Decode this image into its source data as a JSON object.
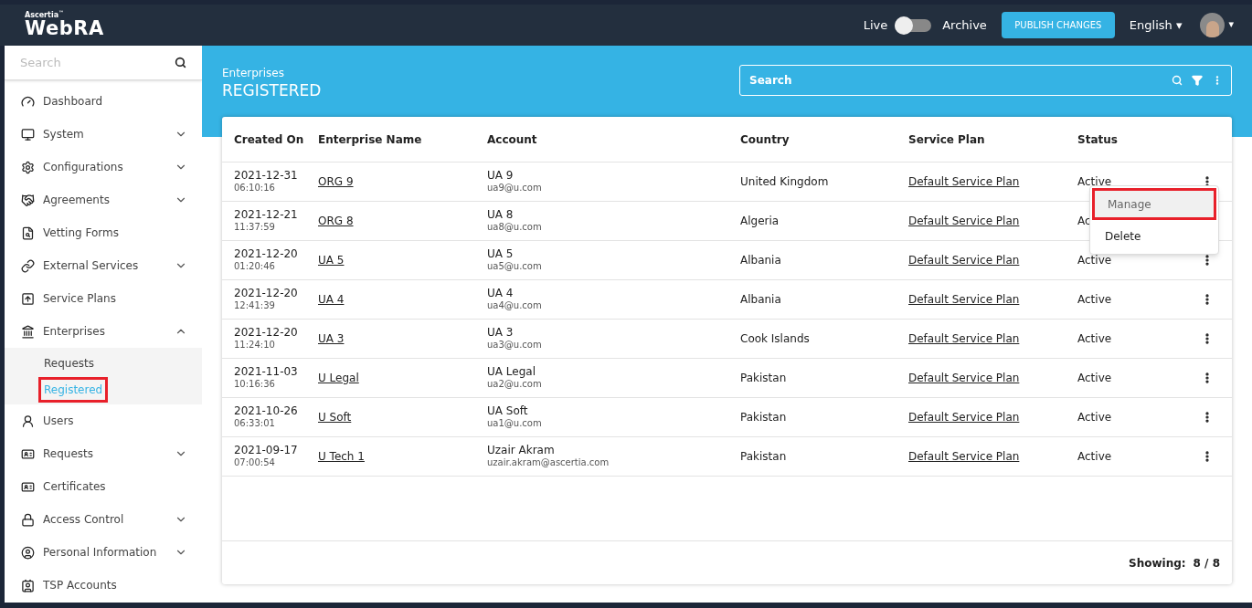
{
  "header": {
    "brand_small": "Ascertia",
    "brand_tm": "™",
    "brand": "WebRA",
    "toggle": {
      "left_label": "Live",
      "right_label": "Archive",
      "on": false
    },
    "publish_button": "PUBLISH CHANGES",
    "language": "English ▾",
    "avatar_caret": "▾"
  },
  "sidebar": {
    "search_placeholder": "Search",
    "items": [
      {
        "label": "Dashboard",
        "kind": "link"
      },
      {
        "label": "System",
        "kind": "group",
        "expanded": false
      },
      {
        "label": "Configurations",
        "kind": "group",
        "expanded": false
      },
      {
        "label": "Agreements",
        "kind": "group",
        "expanded": false
      },
      {
        "label": "Vetting Forms",
        "kind": "link"
      },
      {
        "label": "External Services",
        "kind": "group",
        "expanded": false
      },
      {
        "label": "Service Plans",
        "kind": "link"
      },
      {
        "label": "Enterprises",
        "kind": "group",
        "expanded": true,
        "children": [
          {
            "label": "Requests",
            "selected": false,
            "highlighted": false
          },
          {
            "label": "Registered",
            "selected": true,
            "highlighted": true
          }
        ]
      },
      {
        "label": "Users",
        "kind": "link"
      },
      {
        "label": "Requests",
        "kind": "group",
        "expanded": false
      },
      {
        "label": "Certificates",
        "kind": "link"
      },
      {
        "label": "Access Control",
        "kind": "group",
        "expanded": false
      },
      {
        "label": "Personal Information",
        "kind": "group",
        "expanded": false
      },
      {
        "label": "TSP Accounts",
        "kind": "link"
      }
    ]
  },
  "page": {
    "breadcrumb": "Enterprises",
    "title": "REGISTERED",
    "search_placeholder": "Search"
  },
  "table": {
    "columns": [
      "Created On",
      "Enterprise Name",
      "Account",
      "Country",
      "Service Plan",
      "Status"
    ],
    "rows": [
      {
        "date": "2021-12-31",
        "time": "06:10:16",
        "name": "ORG 9",
        "account": "UA 9",
        "email": "ua9@u.com",
        "country": "United Kingdom",
        "plan": "Default Service Plan",
        "status": "Active"
      },
      {
        "date": "2021-12-21",
        "time": "11:37:59",
        "name": "ORG 8",
        "account": "UA 8",
        "email": "ua8@u.com",
        "country": "Algeria",
        "plan": "Default Service Plan",
        "status": "Ac"
      },
      {
        "date": "2021-12-20",
        "time": "01:20:46",
        "name": "UA 5",
        "account": "UA 5",
        "email": "ua5@u.com",
        "country": "Albania",
        "plan": "Default Service Plan",
        "status": "Active"
      },
      {
        "date": "2021-12-20",
        "time": "12:41:39",
        "name": "UA 4",
        "account": "UA 4",
        "email": "ua4@u.com",
        "country": "Albania",
        "plan": "Default Service Plan",
        "status": "Active"
      },
      {
        "date": "2021-12-20",
        "time": "11:24:10",
        "name": "UA 3",
        "account": "UA 3",
        "email": "ua3@u.com",
        "country": "Cook Islands",
        "plan": "Default Service Plan",
        "status": "Active"
      },
      {
        "date": "2021-11-03",
        "time": "10:16:36",
        "name": "U Legal",
        "account": "UA Legal",
        "email": "ua2@u.com",
        "country": "Pakistan",
        "plan": "Default Service Plan",
        "status": "Active"
      },
      {
        "date": "2021-10-26",
        "time": "06:33:01",
        "name": "U Soft",
        "account": "UA Soft",
        "email": "ua1@u.com",
        "country": "Pakistan",
        "plan": "Default Service Plan",
        "status": "Active"
      },
      {
        "date": "2021-09-17",
        "time": "07:00:54",
        "name": "U Tech 1",
        "account": "Uzair Akram",
        "email": "uzair.akram@ascertia.com",
        "country": "Pakistan",
        "plan": "Default Service Plan",
        "status": "Active"
      }
    ],
    "footer_label": "Showing:",
    "footer_count": "8 / 8"
  },
  "row_menu": {
    "items": [
      {
        "label": "Manage",
        "selected": true,
        "highlighted": true
      },
      {
        "label": "Delete",
        "selected": false,
        "highlighted": false
      }
    ]
  }
}
